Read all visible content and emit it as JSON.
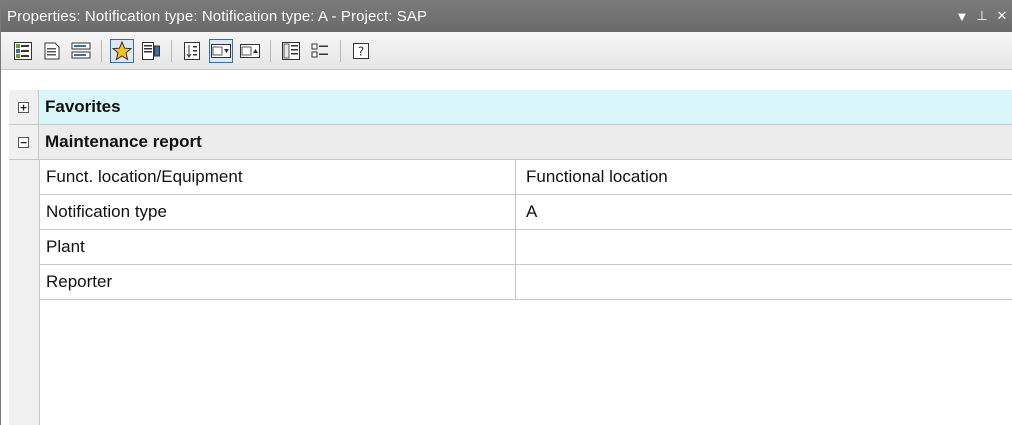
{
  "window": {
    "title": "Properties: Notification type: Notification type: A - Project: SAP",
    "controls": {
      "dropdown": "▼",
      "pin": "⊥",
      "close": "✕"
    }
  },
  "toolbar": {
    "buttons": [
      {
        "icon": "categorized-icon"
      },
      {
        "icon": "properties-page-icon"
      },
      {
        "icon": "grouped-list-icon"
      },
      {
        "icon": "favorites-star-icon",
        "pressed": true
      },
      {
        "icon": "sheet-detail-icon"
      },
      {
        "icon": "sort-icon"
      },
      {
        "icon": "dropdown-expand-icon",
        "pressed": true
      },
      {
        "icon": "dropdown-collapse-icon"
      },
      {
        "icon": "expand-all-icon"
      },
      {
        "icon": "collapse-all-icon"
      },
      {
        "icon": "help-icon"
      }
    ]
  },
  "grid": {
    "categories": {
      "favorites": {
        "label": "Favorites",
        "state": "+"
      },
      "maintenance": {
        "label": "Maintenance report",
        "state": "−"
      }
    },
    "rows": [
      {
        "name": "Funct. location/Equipment",
        "value": "Functional location"
      },
      {
        "name": "Notification type",
        "value": "A"
      },
      {
        "name": "Plant",
        "value": ""
      },
      {
        "name": "Reporter",
        "value": ""
      }
    ]
  },
  "colors": {
    "favorites_bg": "#d9f7fb",
    "titlebar_bg": "#6f6f6f",
    "pressed_border": "#3a6ea5"
  }
}
